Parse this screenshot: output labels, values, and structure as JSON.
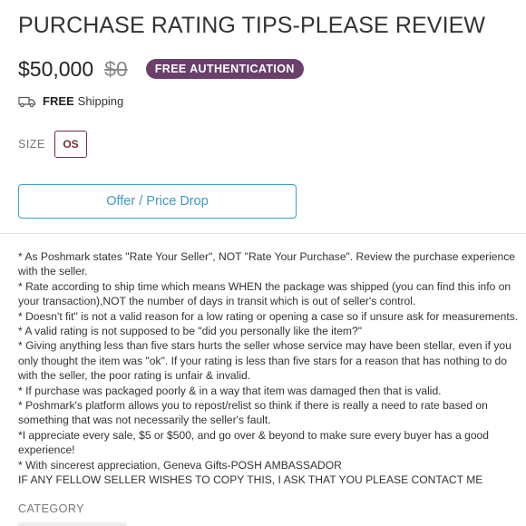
{
  "listing": {
    "title": "PURCHASE RATING TIPS-PLEASE REVIEW",
    "price": "$50,000",
    "original_price": "$0",
    "authentication_badge": "FREE AUTHENTICATION",
    "shipping": {
      "bold": "FREE",
      "text": "Shipping",
      "icon": "truck-icon"
    },
    "size": {
      "label": "SIZE",
      "value": "OS"
    },
    "offer_button": "Offer / Price Drop",
    "description_lines": [
      "* As Poshmark states \"Rate Your Seller\", NOT \"Rate Your Purchase\". Review the purchase experience",
      "with the seller.",
      "* Rate according to ship time which means WHEN the package was shipped (you can find this info on",
      "your transaction),NOT the number of days in transit which is out of seller's control.",
      "* Doesn't fit\" is not a valid reason for a low rating or opening a case so if unsure ask for measurements.",
      "* A valid rating is not supposed to be \"did you personally like the item?\"",
      "* Giving anything less than five stars hurts the seller whose service may have been stellar, even if you",
      "only thought the item was \"ok\". If your rating is less than five stars for a reason that has nothing to do",
      "with the seller, the poor rating is unfair & invalid.",
      "* If purchase was packaged poorly & in a way that item was damaged then that is valid.",
      "* Poshmark's platform allows you to repost/relist so think if there is really a need to rate based on",
      "something that was not necessarily the seller's fault.",
      "*I appreciate every sale, $5 or $500, and go over & beyond to make sure every buyer has a good",
      "experience!",
      "* With sincerest appreciation, Geneva Gifts-POSH AMBASSADOR",
      "IF ANY FELLOW SELLER WISHES TO COPY THIS, I ASK THAT YOU PLEASE CONTACT ME"
    ],
    "category_label": "CATEGORY"
  },
  "colors": {
    "badge_bg": "#6a3f6c",
    "size_accent": "#7a2c38",
    "offer_accent": "#3f9bc1",
    "muted_text": "#777777"
  }
}
